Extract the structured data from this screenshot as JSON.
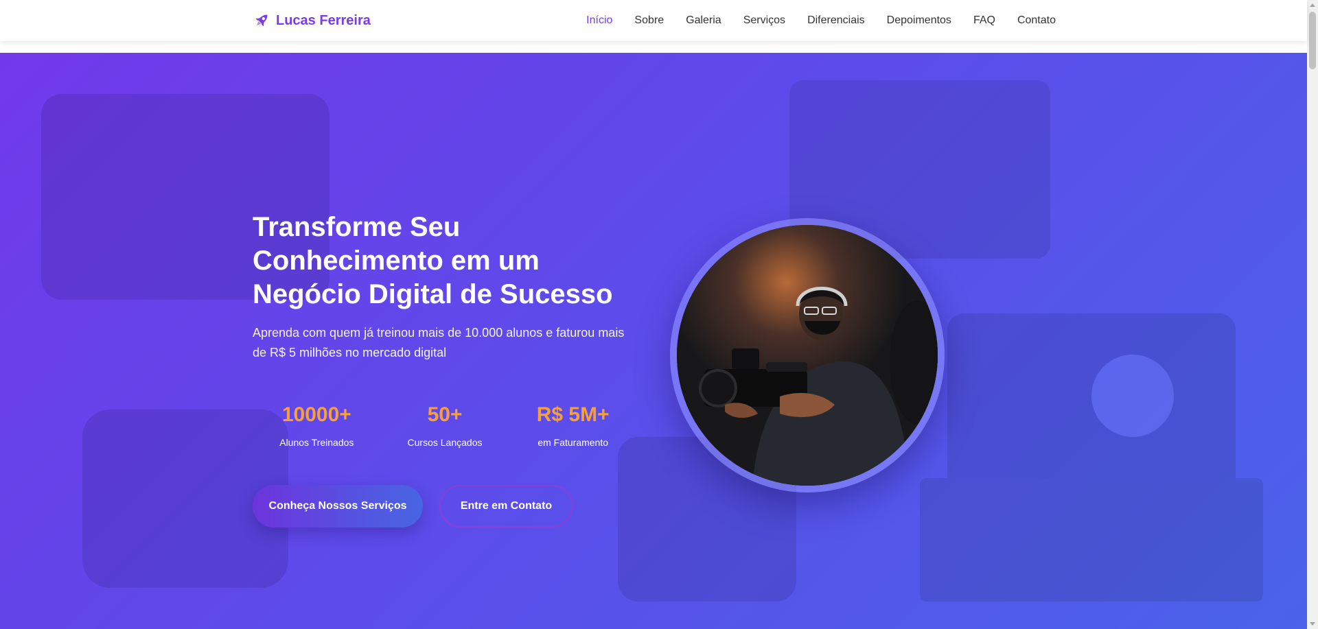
{
  "brand": {
    "name": "Lucas Ferreira",
    "icon": "rocket-icon"
  },
  "nav": {
    "items": [
      {
        "label": "Início",
        "active": true
      },
      {
        "label": "Sobre"
      },
      {
        "label": "Galeria"
      },
      {
        "label": "Serviços"
      },
      {
        "label": "Diferenciais"
      },
      {
        "label": "Depoimentos"
      },
      {
        "label": "FAQ"
      },
      {
        "label": "Contato"
      }
    ]
  },
  "hero": {
    "title_lines": [
      "Transforme Seu",
      "Conhecimento em um",
      "Negócio Digital de Sucesso"
    ],
    "subtitle": "Aprenda com quem já treinou mais de 10.000 alunos e faturou mais de R$ 5 milhões no mercado digital",
    "stats": [
      {
        "value": "10000+",
        "label": "Alunos Treinados"
      },
      {
        "value": "50+",
        "label": "Cursos Lançados"
      },
      {
        "value": "R$ 5M+",
        "label": "em Faturamento"
      }
    ],
    "primary_button": "Conheça Nossos Serviços",
    "secondary_button": "Entre em Contato"
  },
  "colors": {
    "brand": "#7c3aed",
    "hero_gradient_start": "#7239ea",
    "hero_gradient_end": "#4a63ea",
    "stat_accent": "#f7a03b"
  }
}
